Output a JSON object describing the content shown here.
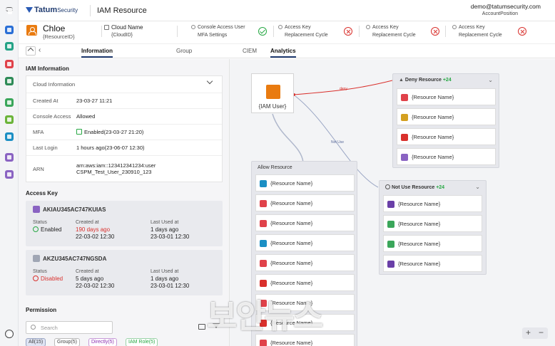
{
  "app": {
    "brand": "Tatum",
    "brand_suffix": "Security",
    "page_title": "IAM Resource"
  },
  "user": {
    "email": "demo@tatumsecurity.com",
    "position": "AccountPosition"
  },
  "identity": {
    "name": "Chloe",
    "resource_id": "{ResourceID}",
    "cloud_name": "Cloud Name",
    "cloud_id": "{CloudID}",
    "checks": [
      {
        "line1": "Console Access User",
        "line2": "MFA Settings",
        "status": "ok"
      },
      {
        "line1": "Access Key",
        "line2": "Replacement Cycle",
        "status": "fail"
      },
      {
        "line1": "Access Key",
        "line2": "Replacement Cycle",
        "status": "fail"
      },
      {
        "line1": "Access Key",
        "line2": "Replacement Cycle",
        "status": "fail"
      }
    ]
  },
  "tabs": [
    "Information",
    "Group",
    "CIEM",
    "Analytics"
  ],
  "iam_info": {
    "title": "IAM Information",
    "dropdown": "Cloud Information",
    "rows": [
      {
        "k": "Created At",
        "v": "23-03-27 11:21"
      },
      {
        "k": "Console Access",
        "v": "Allowed"
      },
      {
        "k": "MFA",
        "v": "Enabled(23-03-27 21:20)"
      },
      {
        "k": "Last Login",
        "v": "1 hours ago(23-06-07 12:30)"
      },
      {
        "k": "ARN",
        "v": "arn:aws:iam::123412341234:user",
        "v2": "CSPM_Test_User_230910_123"
      }
    ]
  },
  "access_key": {
    "title": "Access Key",
    "labels": {
      "status": "Status",
      "created": "Created at",
      "last_used": "Last Used at"
    },
    "keys": [
      {
        "id": "AKIAU345AC747KUIAS",
        "status": "Enabled",
        "created_rel": "190 days ago",
        "created": "22-03-02 12:30",
        "last_rel": "1 days ago",
        "last": "23-03-01 12:30"
      },
      {
        "id": "AKZU345AC747NGSDA",
        "status": "Disabled",
        "created_rel": "5 days ago",
        "created": "22-03-02 12:30",
        "last_rel": "1 days ago",
        "last": "23-03-01 12:30"
      }
    ]
  },
  "permission": {
    "title": "Permission",
    "search_placeholder": "Search",
    "chips": [
      "All(15)",
      "Group(5)",
      "Directly(5)",
      "IAM Role(5)"
    ]
  },
  "analytics": {
    "user_node": "{IAM User}",
    "deny_edge": "deny",
    "notuse_edge": "Not Use",
    "deny_group": {
      "title": "Deny Resource",
      "count": "+24",
      "items": [
        "{Resource Name}",
        "{Resource Name}",
        "{Resource Name}",
        "{Resource Name}"
      ]
    },
    "allow_group": {
      "title": "Allow Resource",
      "items": [
        "{Resource Name}",
        "{Resource Name}",
        "{Resource Name}",
        "{Resource Name}",
        "{Resource Name}",
        "{Resource Name}",
        "{Resource Name}",
        "{Resource Name}",
        "{Resource Name}"
      ]
    },
    "notuse_group": {
      "title": "Not Use Resource",
      "count": "+24",
      "items": [
        "{Resource Name}",
        "{Resource Name}",
        "{Resource Name}",
        "{Resource Name}"
      ]
    },
    "zoom": {
      "plus": "+",
      "minus": "−"
    }
  },
  "watermark": "보안뉴스",
  "colors": {
    "accent": "#1f3b70",
    "ok": "#27a844",
    "fail": "#d9302c",
    "user_orange": "#e97b10",
    "deny_edge": "#d9302c",
    "allow_edge": "#9aa6c4"
  }
}
